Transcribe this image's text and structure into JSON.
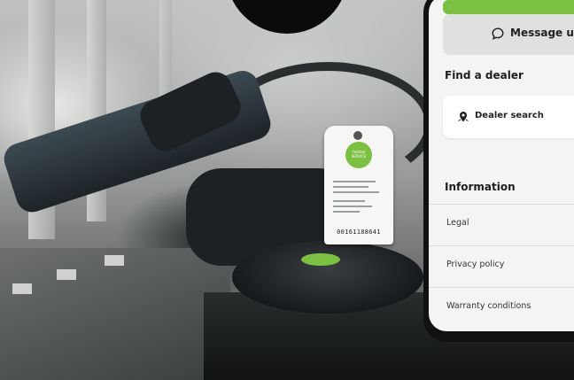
{
  "tag": {
    "badge_text": "Festool SERVICE",
    "serial": "00161188641"
  },
  "app": {
    "message_button": {
      "label": "Message u",
      "icon": "chat-bubble-icon"
    },
    "dealer_section": {
      "title": "Find a dealer",
      "search_label": "Dealer search",
      "search_icon": "location-pin-icon"
    },
    "info_section": {
      "title": "Information",
      "items": [
        {
          "label": "Legal"
        },
        {
          "label": "Privacy policy"
        },
        {
          "label": "Warranty conditions"
        }
      ]
    },
    "colors": {
      "accent": "#7bc043",
      "button_bg": "#dfe1df",
      "screen_bg": "#f3f4f3"
    }
  }
}
